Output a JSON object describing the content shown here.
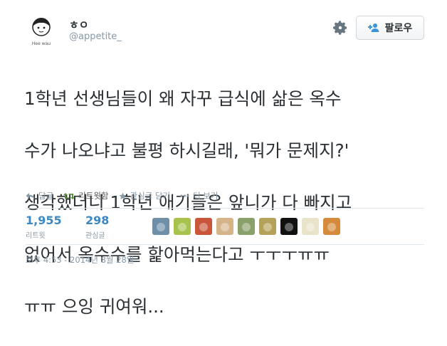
{
  "user": {
    "display_name": "ㅎㅇ",
    "handle": "@appetite_",
    "avatar_caption": "Hee wau"
  },
  "follow_button": {
    "label": "팔로우"
  },
  "tweet": {
    "lines": [
      "1학년 선생님들이 왜 자꾸 급식에 삶은 옥수",
      "수가 나오냐고 불평 하시길래, '뭐가 문제지?'",
      "생각했더니 1학년 애기들은 앞니가 다 빠지고",
      "없어서 옥수수를 핥아먹는다고 ㅜㅜㅜㅠㅠ",
      "ㅠㅠ 으잉 귀여워..."
    ]
  },
  "actions": {
    "reply": "답글",
    "retweet": "리트윗함",
    "favorite": "관심글 담기",
    "more": "더 보기"
  },
  "stats": {
    "retweets": {
      "count": "1,955",
      "label": "리트윗"
    },
    "favorites": {
      "count": "298",
      "label": "관심글"
    }
  },
  "likers": [
    {
      "name": "liker-avatar-1",
      "color": "#6f8fa8"
    },
    {
      "name": "liker-avatar-2",
      "color": "#a9c24e"
    },
    {
      "name": "liker-avatar-3",
      "color": "#c9563a"
    },
    {
      "name": "liker-avatar-4",
      "color": "#d6b48a"
    },
    {
      "name": "liker-avatar-5",
      "color": "#8aa06a"
    },
    {
      "name": "liker-avatar-6",
      "color": "#b5a25a"
    },
    {
      "name": "liker-avatar-7",
      "color": "#111111"
    },
    {
      "name": "liker-avatar-8",
      "color": "#e9e3c9"
    },
    {
      "name": "liker-avatar-9",
      "color": "#d58a3c"
    }
  ],
  "timestamp": "오후 4:53 - 2014년 8월 28일",
  "colors": {
    "retweet_green": "#5c913b",
    "count_blue": "#3b88c3",
    "muted": "#8899a6"
  }
}
